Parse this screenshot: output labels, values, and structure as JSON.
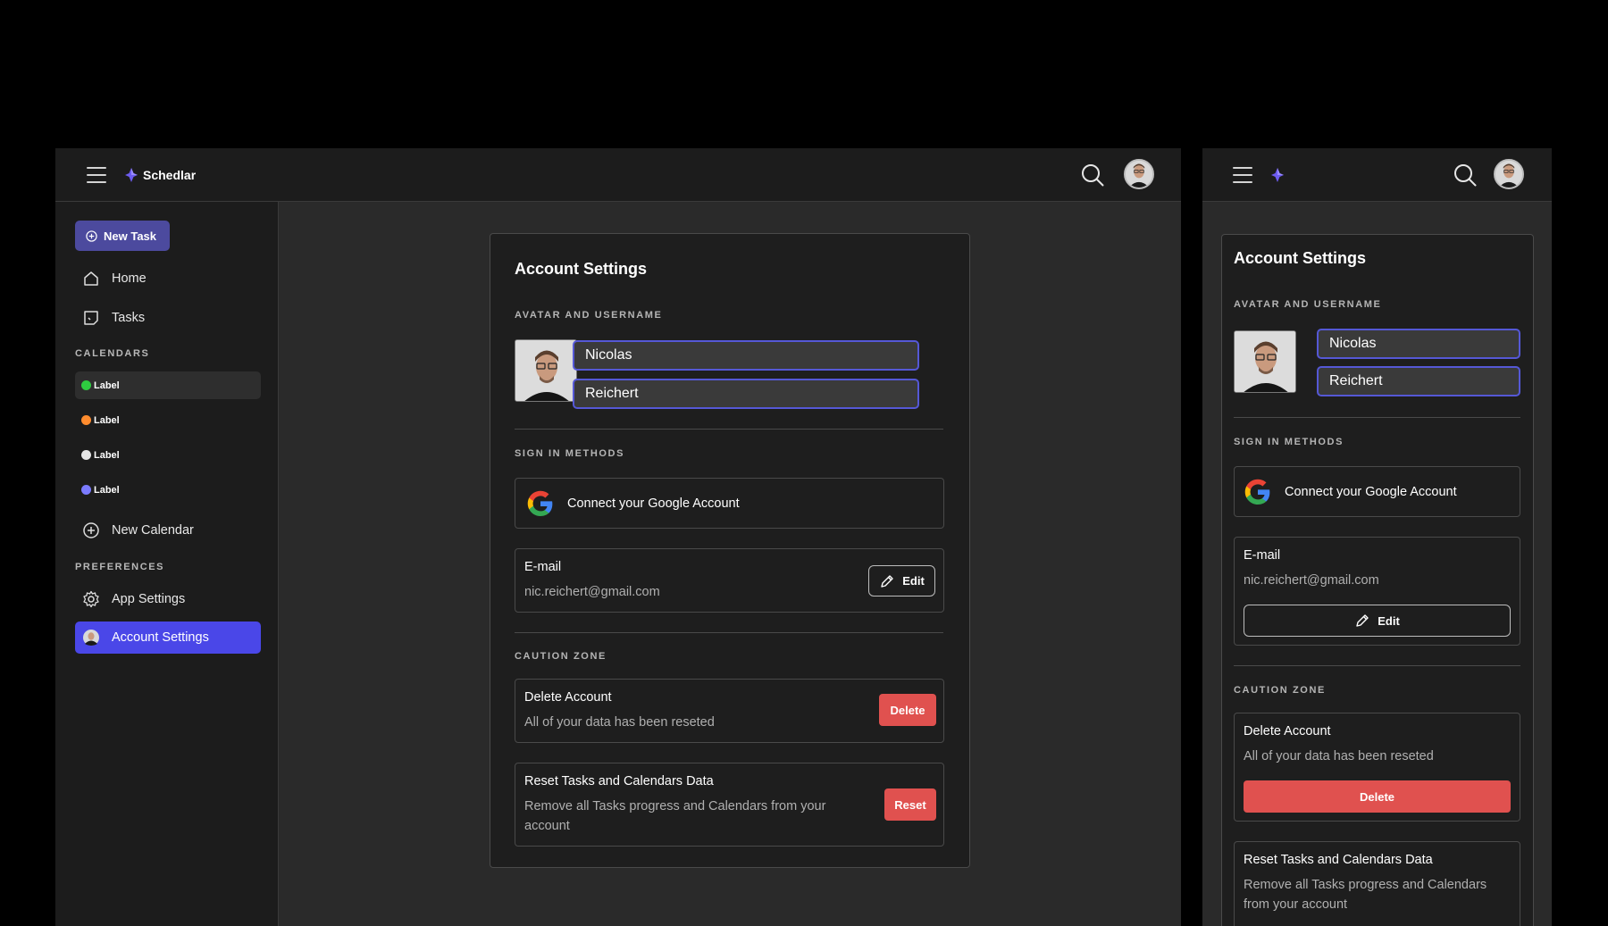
{
  "app": {
    "name": "Schedlar"
  },
  "sidebar": {
    "new_task_label": "New Task",
    "nav": [
      {
        "label": "Home"
      },
      {
        "label": "Tasks"
      }
    ],
    "calendars_heading": "CALENDARS",
    "calendars": [
      {
        "label": "Label",
        "color": "#2ecc40"
      },
      {
        "label": "Label",
        "color": "#ff8c2e"
      },
      {
        "label": "Label",
        "color": "#e6e6e6"
      },
      {
        "label": "Label",
        "color": "#7b7bff"
      }
    ],
    "new_calendar_label": "New Calendar",
    "preferences_heading": "PREFERENCES",
    "app_settings_label": "App Settings",
    "account_settings_label": "Account Settings"
  },
  "settings": {
    "title": "Account Settings",
    "avatar_heading": "AVATAR AND USERNAME",
    "first_name": "Nicolas",
    "last_name": "Reichert",
    "signin_heading": "SIGN IN METHODS",
    "google_label": "Connect your Google Account",
    "email_title": "E-mail",
    "email_value": "nic.reichert@gmail.com",
    "edit_label": "Edit",
    "caution_heading": "CAUTION ZONE",
    "delete_title": "Delete Account",
    "delete_desc": "All of your data has been reseted",
    "delete_label": "Delete",
    "reset_title": "Reset Tasks and Calendars Data",
    "reset_desc": "Remove all Tasks progress and Calendars from your account",
    "reset_label": "Reset"
  },
  "colors": {
    "accent": "#4c4a9e",
    "active_nav": "#4a47e8",
    "danger": "#e0514f",
    "field_border": "#5558d6"
  }
}
